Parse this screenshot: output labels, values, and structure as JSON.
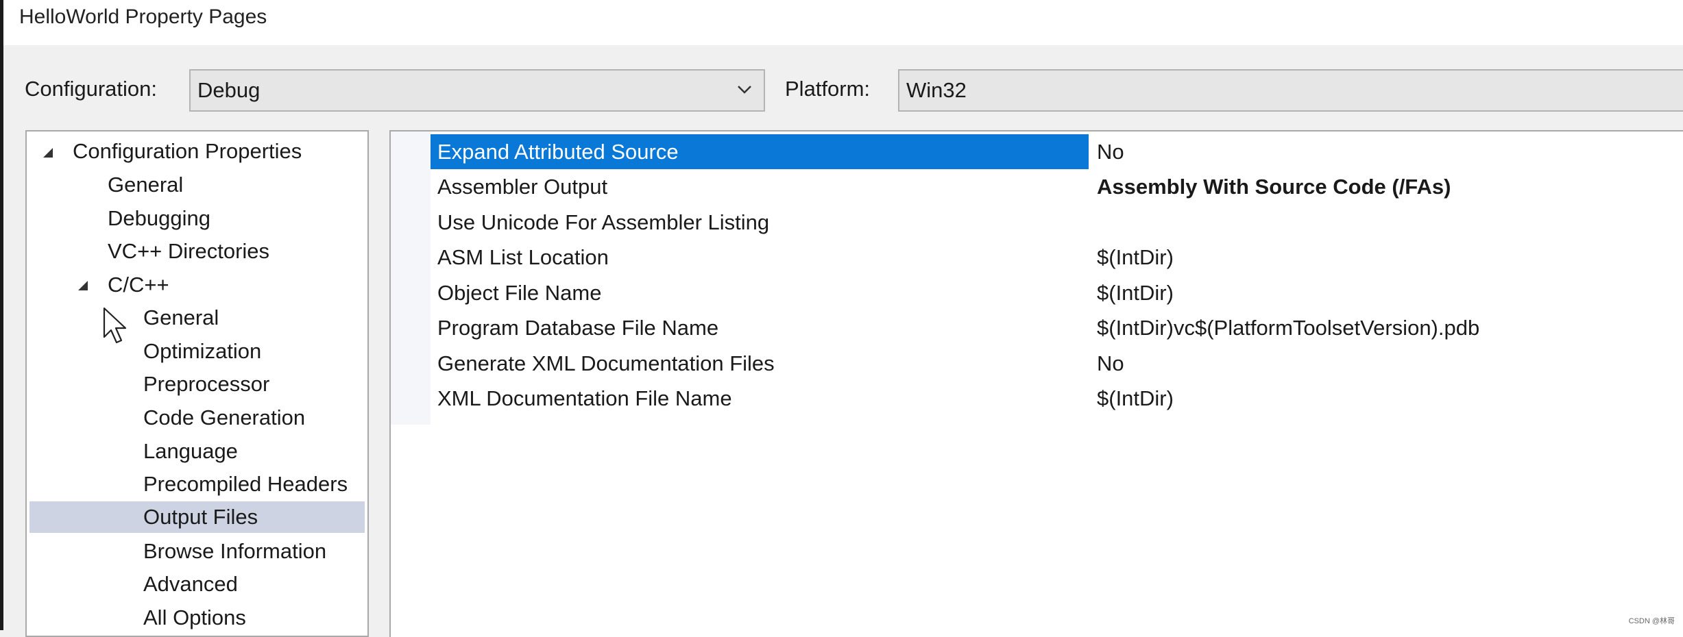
{
  "window": {
    "title": "HelloWorld Property Pages"
  },
  "toolbar": {
    "configuration_label": "Configuration:",
    "configuration_value": "Debug",
    "platform_label": "Platform:",
    "platform_value": "Win32"
  },
  "tree": {
    "root": "Configuration Properties",
    "items": [
      {
        "label": "General"
      },
      {
        "label": "Debugging"
      },
      {
        "label": "VC++ Directories"
      }
    ],
    "cpp": {
      "label": "C/C++",
      "children": [
        {
          "label": "General"
        },
        {
          "label": "Optimization"
        },
        {
          "label": "Preprocessor"
        },
        {
          "label": "Code Generation"
        },
        {
          "label": "Language"
        },
        {
          "label": "Precompiled Headers"
        },
        {
          "label": "Output Files",
          "selected": true
        },
        {
          "label": "Browse Information"
        },
        {
          "label": "Advanced"
        },
        {
          "label": "All Options"
        }
      ]
    }
  },
  "properties": [
    {
      "name": "Expand Attributed Source",
      "value": "No",
      "selected": true
    },
    {
      "name": "Assembler Output",
      "value": "Assembly With Source Code (/FAs)",
      "bold": true
    },
    {
      "name": "Use Unicode For Assembler Listing",
      "value": ""
    },
    {
      "name": "ASM List Location",
      "value": "$(IntDir)"
    },
    {
      "name": "Object File Name",
      "value": "$(IntDir)"
    },
    {
      "name": "Program Database File Name",
      "value": "$(IntDir)vc$(PlatformToolsetVersion).pdb"
    },
    {
      "name": "Generate XML Documentation Files",
      "value": "No"
    },
    {
      "name": "XML Documentation File Name",
      "value": "$(IntDir)"
    }
  ],
  "watermark": "CSDN @林哥",
  "colors": {
    "selection_blue": "#0a78d7",
    "tree_selection": "#cdd3e2"
  },
  "icons": {
    "combo_dropdown": "chevron-down-icon",
    "tree_expander": "expanded-triangle-icon",
    "pointer": "mouse-cursor-icon"
  }
}
